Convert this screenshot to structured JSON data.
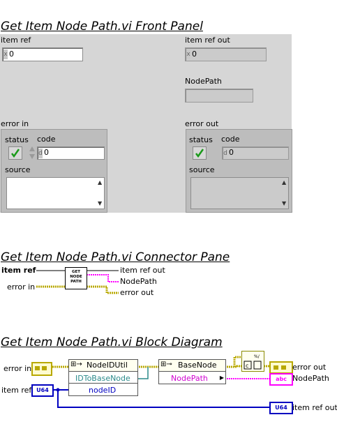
{
  "front_panel": {
    "title": "Get Item Node Path.vi Front Panel",
    "item_ref_label": "item ref",
    "item_ref_value": "0",
    "item_ref_out_label": "item ref out",
    "item_ref_out_value": "0",
    "nodepath_label": "NodePath",
    "nodepath_value": "",
    "error_in_label": "error in",
    "error_out_label": "error out",
    "status_label": "status",
    "code_label": "code",
    "code_value": "0",
    "source_label": "source",
    "status_icon": "green-check-icon"
  },
  "connector_pane": {
    "title": "Get Item Node Path.vi Connector Pane",
    "item_ref_label": "item ref",
    "error_in_label": "error in",
    "item_ref_out_label": "item ref out",
    "nodepath_label": "NodePath",
    "error_out_label": "error out",
    "icon_lines": [
      "GET",
      "NODE",
      "PATH"
    ]
  },
  "block_diagram": {
    "title": "Get Item Node Path.vi Block Diagram",
    "error_in_label": "error in",
    "item_ref_label": "item ref",
    "error_out_label": "error out",
    "nodepath_label": "NodePath",
    "item_ref_out_label": "item ref out",
    "u64_tag": "U64",
    "abc_tag": "abc",
    "node1_class": "NodeIDUtil",
    "node1_method": "IDToBaseNode",
    "node1_prop": "nodeID",
    "node2_class": "BaseNode",
    "node2_prop": "NodePath",
    "wire_colors": {
      "error": "#b8a800",
      "refnum": "#2a8a8a",
      "u64": "#0000c0",
      "string": "#ff00ff"
    }
  }
}
